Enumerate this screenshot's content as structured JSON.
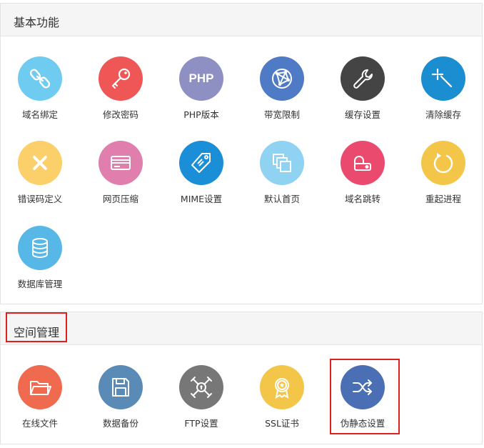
{
  "basic": {
    "title": "基本功能",
    "items": [
      {
        "label": "域名绑定",
        "icon": "link-icon",
        "color": "#6fcbef"
      },
      {
        "label": "修改密码",
        "icon": "key-icon",
        "color": "#ef5656"
      },
      {
        "label": "PHP版本",
        "icon": "php-icon",
        "color": "#8e8fc2",
        "text": "PHP"
      },
      {
        "label": "带宽限制",
        "icon": "network-icon",
        "color": "#4f7ac5"
      },
      {
        "label": "缓存设置",
        "icon": "wrench-icon",
        "color": "#444444"
      },
      {
        "label": "清除缓存",
        "icon": "magic-wand-icon",
        "color": "#1b8dd1"
      },
      {
        "label": "错误码定义",
        "icon": "close-icon",
        "color": "#fbd06a"
      },
      {
        "label": "网页压缩",
        "icon": "card-icon",
        "color": "#e07fae"
      },
      {
        "label": "MIME设置",
        "icon": "tag-icon",
        "color": "#1a8fd7"
      },
      {
        "label": "默认首页",
        "icon": "pages-icon",
        "color": "#8fd2f1"
      },
      {
        "label": "域名跳转",
        "icon": "redirect-icon",
        "color": "#ea4a6e"
      },
      {
        "label": "重起进程",
        "icon": "restart-icon",
        "color": "#f3c64a"
      },
      {
        "label": "数据库管理",
        "icon": "database-icon",
        "color": "#57b8e8"
      }
    ]
  },
  "space": {
    "title": "空间管理",
    "items": [
      {
        "label": "在线文件",
        "icon": "folder-icon",
        "color": "#ef6a4f"
      },
      {
        "label": "数据备份",
        "icon": "floppy-disk-icon",
        "color": "#5a8bb6"
      },
      {
        "label": "FTP设置",
        "icon": "ftp-network-icon",
        "color": "#777777"
      },
      {
        "label": "SSL证书",
        "icon": "certificate-badge-icon",
        "color": "#f3c64a"
      },
      {
        "label": "伪静态设置",
        "icon": "shuffle-icon",
        "color": "#4a6fb4"
      }
    ]
  },
  "highlight_color": "#e02020"
}
